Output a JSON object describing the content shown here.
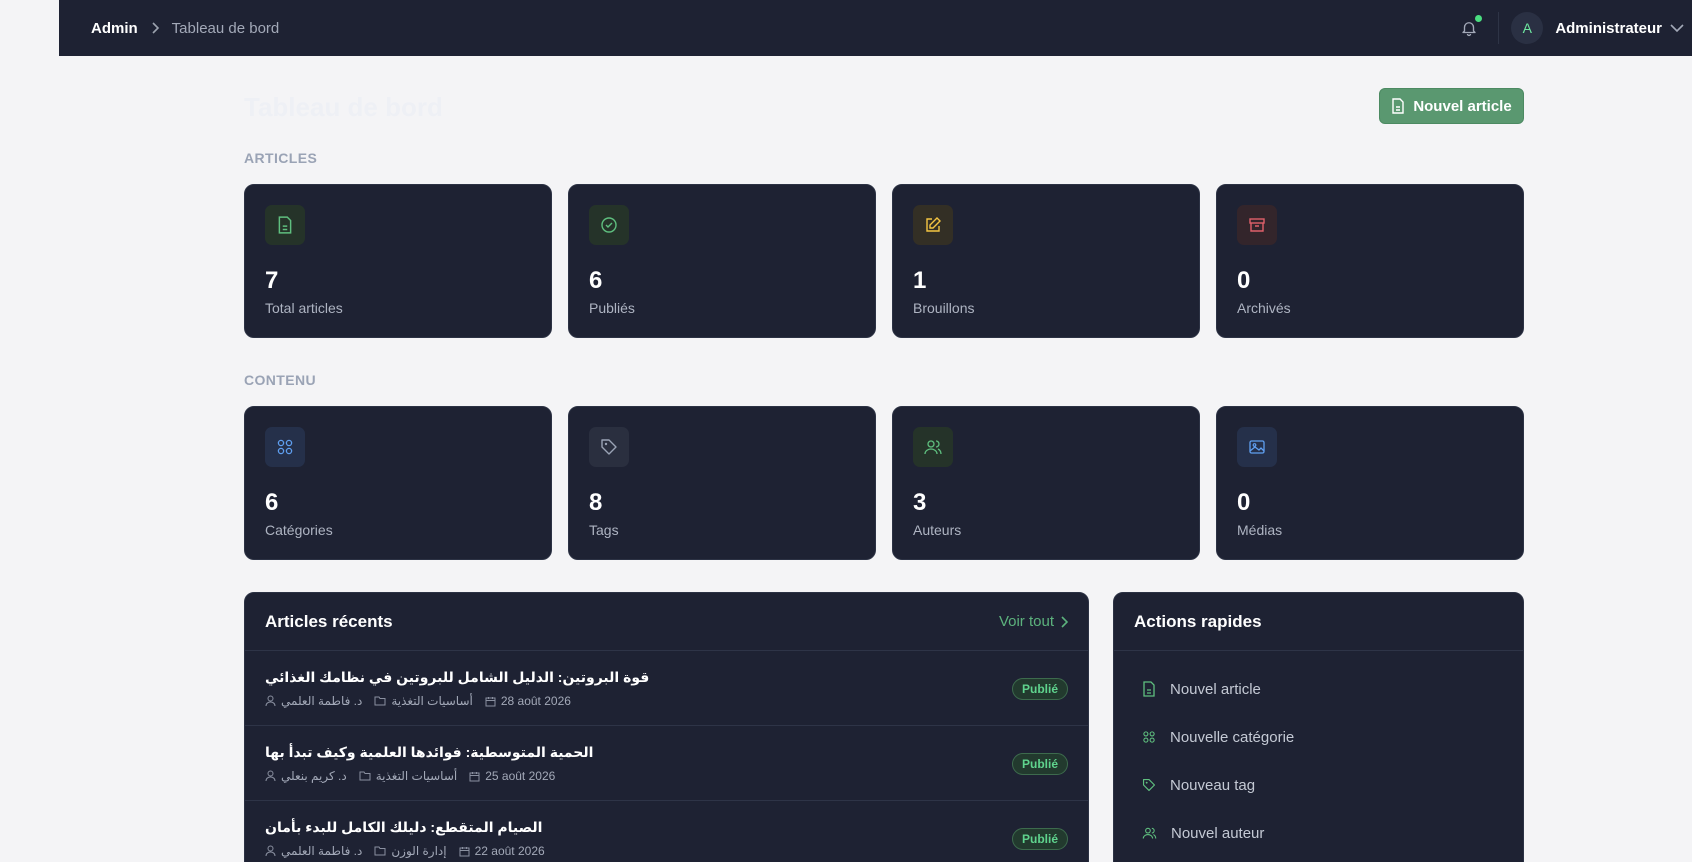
{
  "breadcrumb": {
    "root": "Admin",
    "current": "Tableau de bord"
  },
  "user": {
    "initial": "A",
    "name": "Administrateur"
  },
  "page": {
    "title": "Tableau de bord",
    "new_article_label": "Nouvel article"
  },
  "sections": {
    "articles": {
      "label": "ARTICLES",
      "cards": [
        {
          "value": "7",
          "label": "Total articles",
          "icon": "document-icon",
          "color": "#5fbf7f"
        },
        {
          "value": "6",
          "label": "Publiés",
          "icon": "check-circle-icon",
          "color": "#5fbf7f"
        },
        {
          "value": "1",
          "label": "Brouillons",
          "icon": "edit-icon",
          "color": "#f5c542"
        },
        {
          "value": "0",
          "label": "Archivés",
          "icon": "archive-icon",
          "color": "#e0606a"
        }
      ]
    },
    "content": {
      "label": "CONTENU",
      "cards": [
        {
          "value": "6",
          "label": "Catégories",
          "icon": "grid-icon",
          "color": "#5f9ff0"
        },
        {
          "value": "8",
          "label": "Tags",
          "icon": "tag-icon",
          "color": "#9aa3b5"
        },
        {
          "value": "3",
          "label": "Auteurs",
          "icon": "users-icon",
          "color": "#5fbf7f"
        },
        {
          "value": "0",
          "label": "Médias",
          "icon": "image-icon",
          "color": "#5f9ff0"
        }
      ]
    }
  },
  "recent": {
    "title": "Articles récents",
    "view_all": "Voir tout",
    "items": [
      {
        "title": "قوة البروتين: الدليل الشامل للبروتين في نظامك الغذائي",
        "author": "د. فاطمة العلمي",
        "category": "أساسيات التغذية",
        "date": "28 août 2026",
        "status": "Publié"
      },
      {
        "title": "الحمية المتوسطية: فوائدها العلمية وكيف تبدأ بها",
        "author": "د. كريم بنعلي",
        "category": "أساسيات التغذية",
        "date": "25 août 2026",
        "status": "Publié"
      },
      {
        "title": "الصيام المتقطع: دليلك الكامل للبدء بأمان",
        "author": "د. فاطمة العلمي",
        "category": "إدارة الوزن",
        "date": "22 août 2026",
        "status": "Publié"
      }
    ]
  },
  "quick_actions": {
    "title": "Actions rapides",
    "items": [
      {
        "label": "Nouvel article",
        "icon": "document-icon"
      },
      {
        "label": "Nouvelle catégorie",
        "icon": "grid-icon"
      },
      {
        "label": "Nouveau tag",
        "icon": "tag-icon"
      },
      {
        "label": "Nouvel auteur",
        "icon": "users-icon"
      }
    ]
  },
  "colors": {
    "accent": "#5a9870",
    "panel": "#1e2233",
    "background": "#f4f4f6"
  }
}
